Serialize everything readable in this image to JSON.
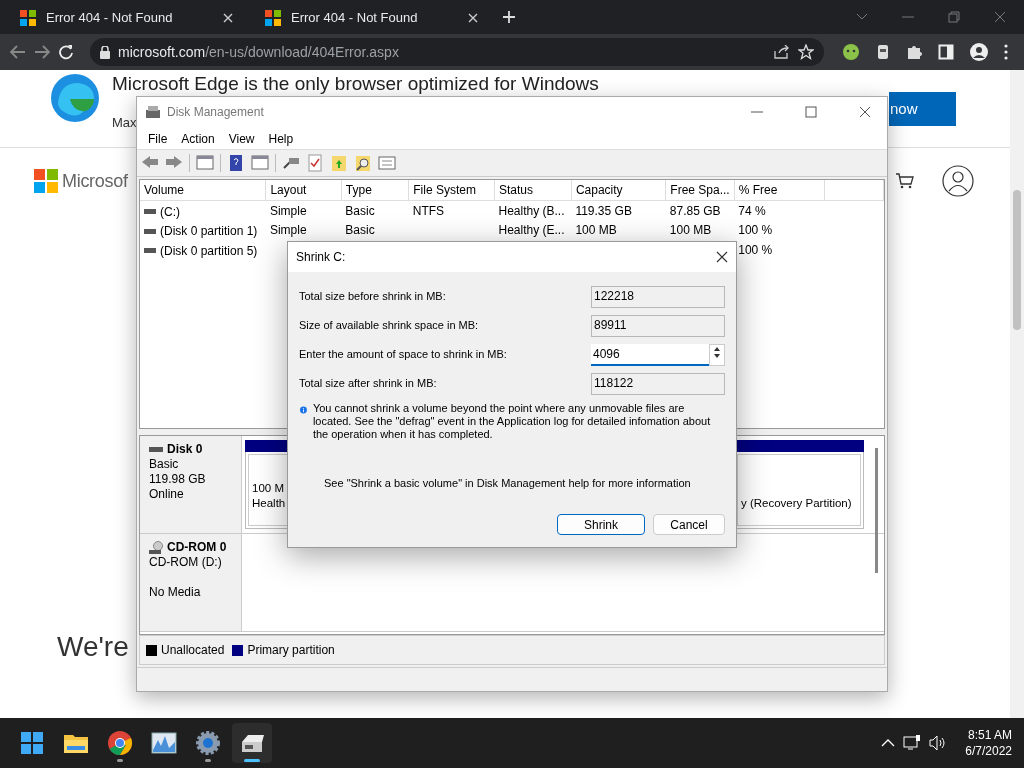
{
  "browser": {
    "tabs": [
      {
        "title": "Error 404 - Not Found"
      },
      {
        "title": "Error 404 - Not Found"
      }
    ],
    "address": {
      "domain": "microsoft.com",
      "path": "/en-us/download/404Error.aspx"
    },
    "page": {
      "banner_title": "Microsoft Edge is the only browser optimized for Windows",
      "banner_subtitle": "Max",
      "banner_button": "now",
      "logo_text": "Microsof",
      "heading": "We're"
    }
  },
  "disk_management": {
    "title": "Disk Management",
    "menu": [
      "File",
      "Action",
      "View",
      "Help"
    ],
    "columns": [
      "Volume",
      "Layout",
      "Type",
      "File System",
      "Status",
      "Capacity",
      "Free Spa...",
      "% Free"
    ],
    "volumes": [
      {
        "volume": "(C:)",
        "layout": "Simple",
        "type": "Basic",
        "file_system": "NTFS",
        "status": "Healthy (B...",
        "capacity": "119.35 GB",
        "free_space": "87.85 GB",
        "percent_free": "74 %"
      },
      {
        "volume": "(Disk 0 partition 1)",
        "layout": "Simple",
        "type": "Basic",
        "status": "Healthy (E...",
        "capacity": "100 MB",
        "free_space": "100 MB",
        "percent_free": "100 %"
      },
      {
        "volume": "(Disk 0 partition 5)",
        "percent_free": "100 %"
      }
    ],
    "disks": [
      {
        "name": "Disk 0",
        "kind": "disk",
        "lines": [
          "Basic",
          "119.98 GB",
          "Online"
        ],
        "partitions": [
          {
            "lines": [
              "100 M",
              "Health"
            ]
          },
          {
            "lines": [
              "y (Recovery Partition)"
            ]
          }
        ]
      },
      {
        "name": "CD-ROM 0",
        "kind": "cdrom",
        "lines": [
          "CD-ROM (D:)",
          "No Media"
        ]
      }
    ],
    "legend": [
      {
        "label": "Unallocated",
        "color": "#000000"
      },
      {
        "label": "Primary partition",
        "color": "#000080"
      }
    ]
  },
  "dialog": {
    "title": "Shrink C:",
    "fields": [
      {
        "label": "Total size before shrink in MB:",
        "value": "122218",
        "kind": "readonly"
      },
      {
        "label": "Size of available shrink space in MB:",
        "value": "89911",
        "kind": "readonly"
      },
      {
        "label": "Enter the amount of space to shrink in MB:",
        "value": "4096",
        "kind": "spin"
      },
      {
        "label": "Total size after shrink in MB:",
        "value": "118122",
        "kind": "readonly"
      }
    ],
    "info": "You cannot shrink a volume beyond the point where any unmovable files are located. See the \"defrag\" event in the Application log for detailed infomation about the operation when it has completed.",
    "help": "See \"Shrink a basic volume\" in Disk Management help for more information",
    "buttons": [
      {
        "label": "Shrink",
        "default": true
      },
      {
        "label": "Cancel",
        "default": false
      }
    ]
  },
  "taskbar": {
    "apps": [
      {
        "kind": "start",
        "active": false,
        "running": false
      },
      {
        "kind": "folder",
        "active": false,
        "running": false
      },
      {
        "kind": "chrome",
        "active": false,
        "running": true
      },
      {
        "kind": "monitor",
        "active": false,
        "running": false
      },
      {
        "kind": "settings",
        "active": false,
        "running": true
      },
      {
        "kind": "diskmgmt",
        "active": true,
        "running": true
      }
    ],
    "time": "8:51 AM",
    "date": "6/7/2022"
  }
}
